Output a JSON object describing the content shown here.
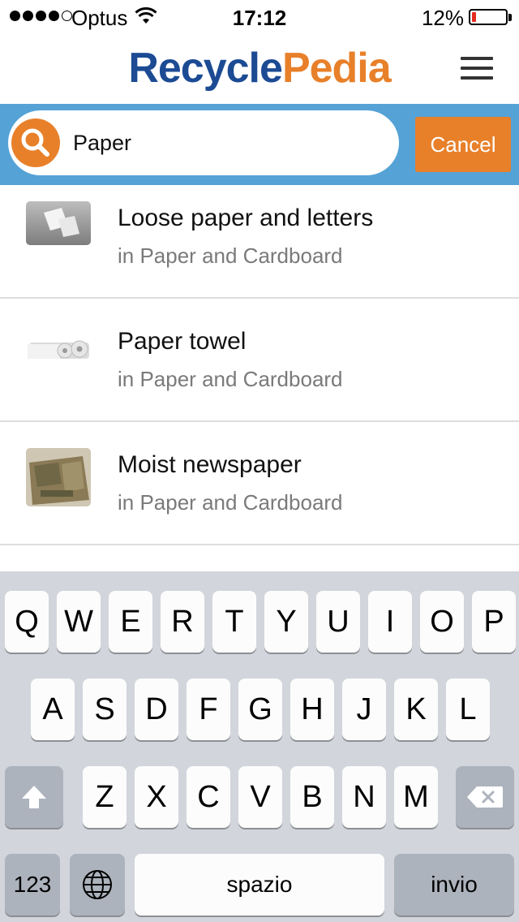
{
  "status": {
    "carrier": "Optus",
    "time": "17:12",
    "battery": "12%",
    "battery_level": 0.12,
    "battery_color": "#e52b1f"
  },
  "header": {
    "logo_part1": "Recycle",
    "logo_part2": "Pedia",
    "brand_blue": "#1c4b94",
    "brand_orange": "#e8802a",
    "menu_icon": "hamburger-icon"
  },
  "search": {
    "value": "Paper",
    "cancel_label": "Cancel",
    "icon": "search-icon",
    "bar_color": "#55a2d6"
  },
  "results": [
    {
      "title": "Loose paper and letters",
      "category": "in Paper and Cardboard",
      "thumb": "paper-sheets"
    },
    {
      "title": "Paper towel",
      "category": "in Paper and Cardboard",
      "thumb": "paper-towel-rolls"
    },
    {
      "title": "Moist newspaper",
      "category": "in Paper and Cardboard",
      "thumb": "newspaper"
    }
  ],
  "keyboard": {
    "row1": [
      "Q",
      "W",
      "E",
      "R",
      "T",
      "Y",
      "U",
      "I",
      "O",
      "P"
    ],
    "row2": [
      "A",
      "S",
      "D",
      "F",
      "G",
      "H",
      "J",
      "K",
      "L"
    ],
    "row3": [
      "Z",
      "X",
      "C",
      "V",
      "B",
      "N",
      "M"
    ],
    "numbers_label": "123",
    "globe_icon": "globe-icon",
    "space_label": "spazio",
    "return_label": "invio",
    "shift_icon": "shift-icon",
    "delete_icon": "delete-icon"
  }
}
